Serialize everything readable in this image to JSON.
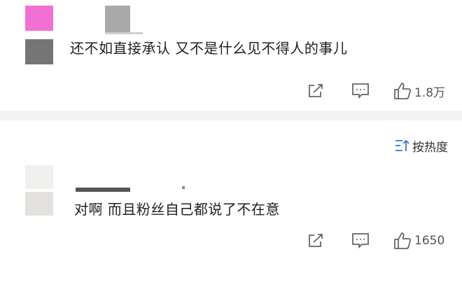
{
  "comments": [
    {
      "text": "还不如直接承认 又不是什么见不得人的事儿",
      "like_count": "1.8万"
    },
    {
      "text": "对啊 而且粉丝自己都说了不在意",
      "like_count": "1650"
    }
  ],
  "sort": {
    "label": "按热度"
  },
  "icons": {
    "share": "share-icon",
    "comment": "comment-icon",
    "like": "thumbs-up-icon",
    "sort": "sort-icon"
  },
  "colors": {
    "text": "#1f1f1f",
    "icon": "#666666",
    "separator": "#f3f3f3"
  }
}
